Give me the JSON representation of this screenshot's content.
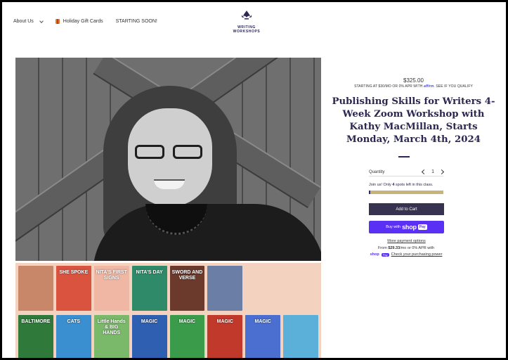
{
  "header": {
    "nav": [
      {
        "label": "About Us",
        "has_dropdown": true
      },
      {
        "label": "Holiday Gift Cards",
        "icon": "gift-icon"
      },
      {
        "label": "STARTING SOON!"
      }
    ],
    "logo": {
      "line1": "WRITING",
      "line2": "WORKSHOPS",
      "color": "#2b2752"
    }
  },
  "product": {
    "price": "$325.00",
    "installment_prefix": "STARTING AT $30/MO OR 0% APR WITH",
    "installment_brand": "affirm",
    "installment_suffix": ". SEE IF YOU QUALIFY",
    "title": "Publishing Skills for Writers 4-Week Zoom Workshop with Kathy MacMillan, Starts Monday, March 4th, 2024",
    "quantity_label": "Quantity",
    "quantity_value": "1",
    "stock_prefix": "Join us! Only",
    "stock_count": "4",
    "stock_suffix": "spots left in this class.",
    "stock_fraction": 0.02,
    "add_to_cart": "Add to Cart",
    "buy_with": "Buy with",
    "shop_logo": "shop",
    "shop_pay": "Pay",
    "more_payment_options": "More payment options",
    "from_prefix": "From",
    "from_amount": "$29.33",
    "from_suffix": "/mo or 0% APR with",
    "mini_shop": "shop",
    "mini_pay": "Pay",
    "check_purchasing_power": "Check your purchasing power"
  },
  "books": [
    {
      "title": "",
      "color": "#c9876a"
    },
    {
      "title": "SHE SPOKE",
      "color": "#d9533f"
    },
    {
      "title": "NITA'S FIRST SIGNS",
      "color": "#f0b7a4"
    },
    {
      "title": "NITA'S DAY",
      "color": "#2f8a6a"
    },
    {
      "title": "SWORD AND VERSE",
      "color": "#6b3a2c"
    },
    {
      "title": "",
      "color": "#6b7fa6"
    },
    {
      "title": "",
      "color": "#f3d3c0"
    },
    {
      "title": "",
      "color": "#f3d3c0"
    },
    {
      "title": "BALTIMORE",
      "color": "#2f7a3a"
    },
    {
      "title": "CATS",
      "color": "#3a8fd0"
    },
    {
      "title": "Little Hands & BIG HANDS",
      "color": "#7ab86a"
    },
    {
      "title": "MAGIC",
      "color": "#2f5fb0"
    },
    {
      "title": "MAGIC",
      "color": "#3a9b4a"
    },
    {
      "title": "MAGIC",
      "color": "#c0392b"
    },
    {
      "title": "MAGIC",
      "color": "#4a6fd0"
    },
    {
      "title": "",
      "color": "#5ab0d8"
    }
  ]
}
